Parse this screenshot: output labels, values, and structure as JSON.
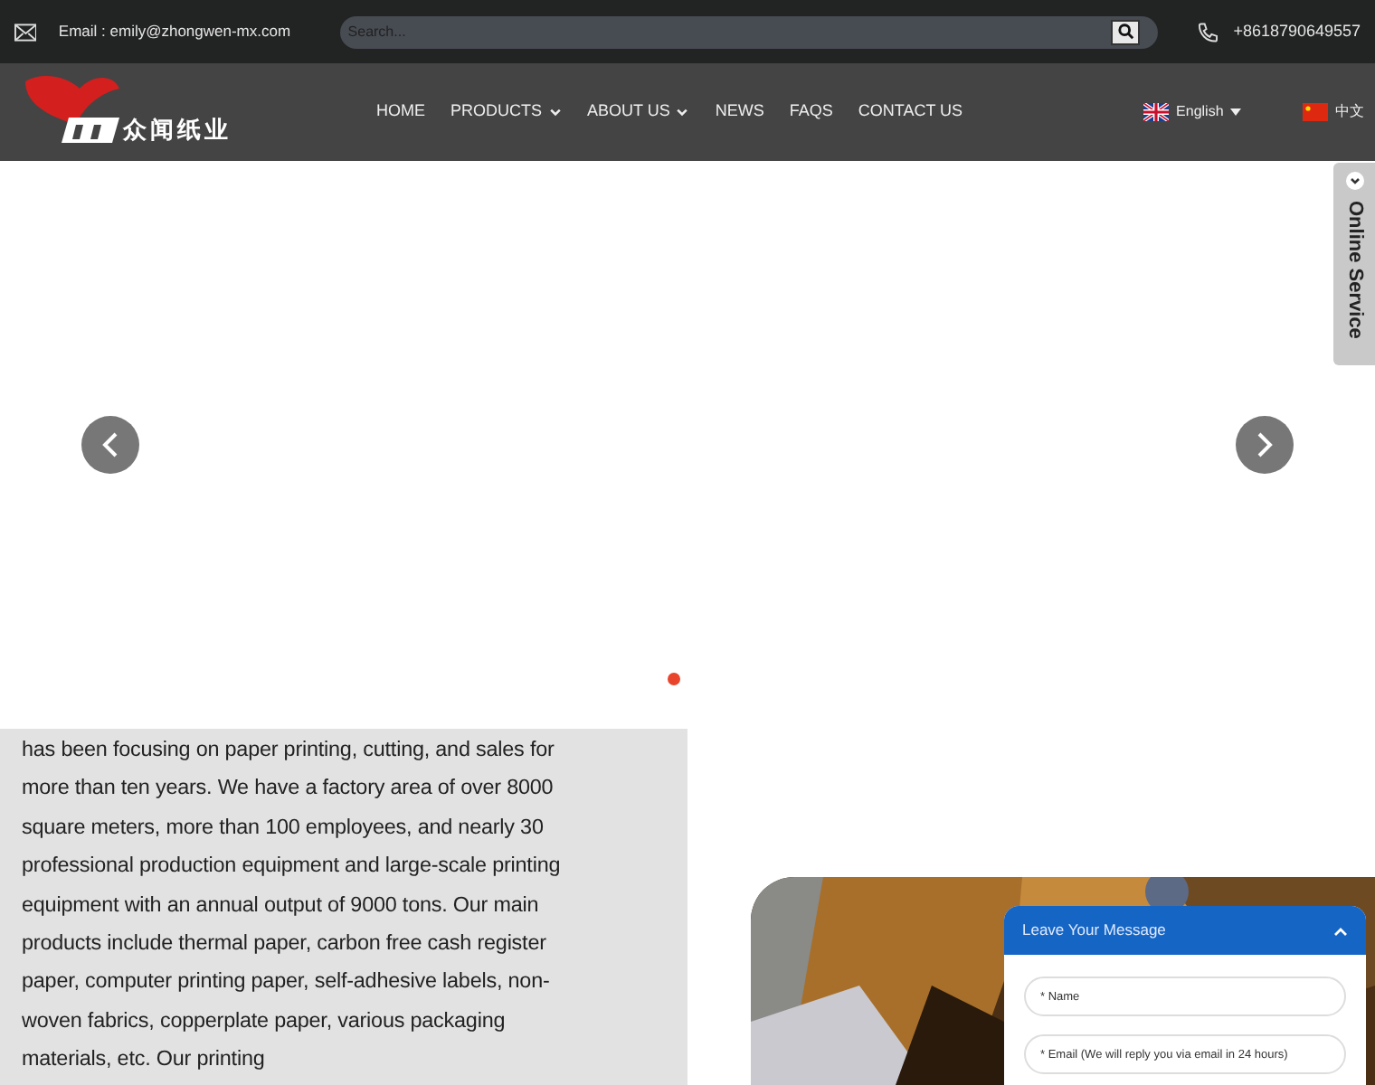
{
  "top_bar": {
    "email": "Email : emily@zhongwen-mx.com",
    "search": {
      "placeholder": "Search..."
    },
    "phone": "+8618790649557"
  },
  "nav": {
    "logo_text": "众闻纸业",
    "items": [
      {
        "label": "HOME",
        "dropdown": false
      },
      {
        "label": "PRODUCTS",
        "dropdown": true
      },
      {
        "label": "ABOUT US",
        "dropdown": true
      },
      {
        "label": "NEWS",
        "dropdown": false
      },
      {
        "label": "FAQS",
        "dropdown": false
      },
      {
        "label": "CONTACT US",
        "dropdown": false
      }
    ],
    "languages": [
      {
        "label": "English",
        "kind": "uk",
        "dropdown": true
      },
      {
        "label": "中文",
        "kind": "cn",
        "dropdown": false
      }
    ]
  },
  "hero": {
    "dots": [
      {
        "selected": true
      }
    ]
  },
  "side_tab": {
    "label": "Online Service"
  },
  "about": {
    "text": "has been focusing on paper printing, cutting, and sales for more than ten years. We have a factory area of over 8000 square meters, more than 100 employees, and nearly 30 professional production equipment and large-scale printing equipment with an annual output of 9000 tons. Our main products include thermal paper, carbon free cash register paper, computer printing paper, self-adhesive labels, non-woven fabrics, copperplate paper, various packaging materials, etc. Our printing"
  },
  "chat": {
    "title": "Leave Your Message",
    "fields": [
      {
        "placeholder": "* Name"
      },
      {
        "placeholder": "* Email (We will reply you via email in 24 hours)"
      }
    ]
  }
}
